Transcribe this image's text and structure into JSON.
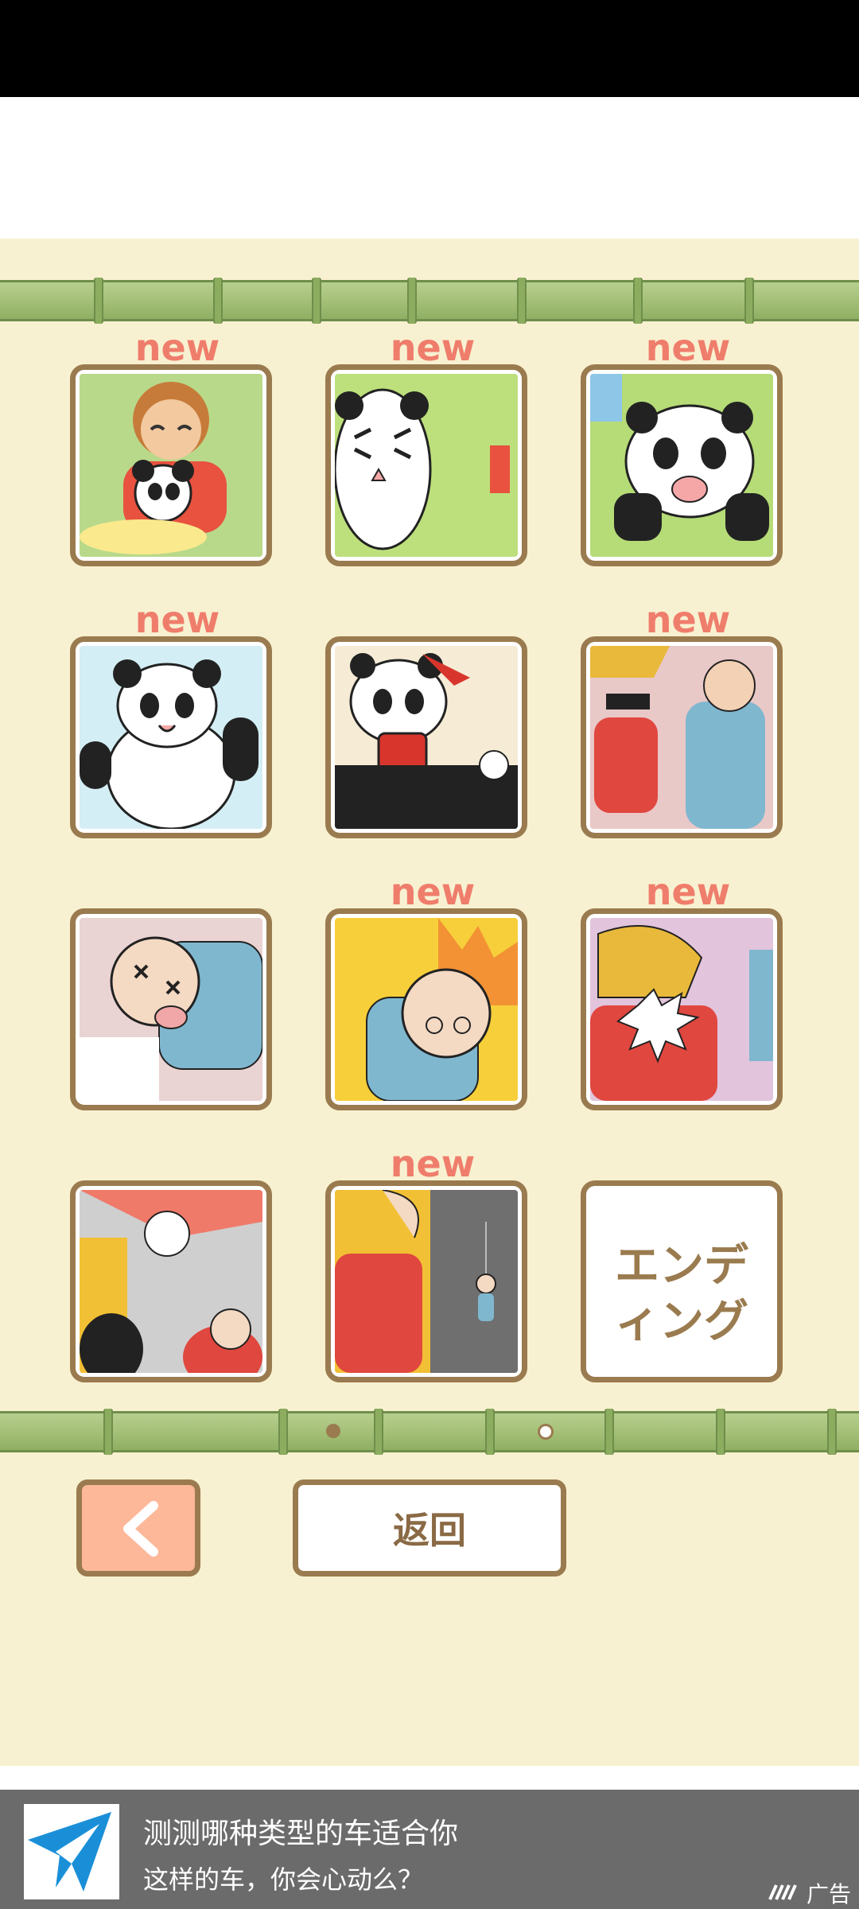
{
  "gallery": {
    "new_label": "new",
    "tiles": [
      {
        "id": "panda-monkey",
        "is_new": true
      },
      {
        "id": "panda-dizzy",
        "is_new": true
      },
      {
        "id": "panda-crying",
        "is_new": true
      },
      {
        "id": "panda-happy",
        "is_new": true
      },
      {
        "id": "panda-bomb",
        "is_new": false
      },
      {
        "id": "workers-standing",
        "is_new": true
      },
      {
        "id": "bald-man-knocked-out",
        "is_new": false
      },
      {
        "id": "bald-man-fire",
        "is_new": true
      },
      {
        "id": "blond-man-hit",
        "is_new": true
      },
      {
        "id": "cat-alarm",
        "is_new": false
      },
      {
        "id": "falling-scene",
        "is_new": true
      },
      {
        "id": "ending",
        "is_new": false,
        "label": "エンディング"
      }
    ],
    "ending_line1": "エンデ",
    "ending_line2": "ィング"
  },
  "pager": {
    "page_count": 2,
    "current_page": 2
  },
  "nav": {
    "prev_icon": "chevron-left-icon",
    "back_label": "返回"
  },
  "ad": {
    "title": "测测哪种类型的车适合你",
    "subtitle": "这样的车，你会心动么？",
    "badge_label": "广告"
  },
  "colors": {
    "background": "#f8f1d1",
    "frame": "#9a7b4f",
    "new_label": "#ef7d6c",
    "prev_button": "#fdb899",
    "bamboo": "#a7c27a"
  }
}
